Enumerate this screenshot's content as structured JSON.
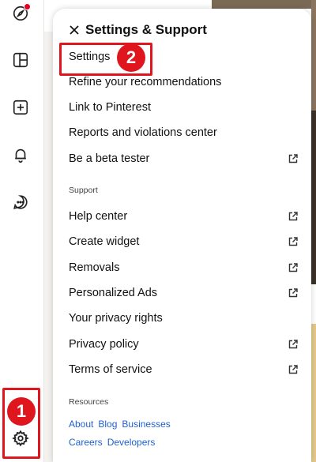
{
  "menu": {
    "title": "Settings & Support",
    "items": [
      {
        "label": "Settings",
        "external": false
      },
      {
        "label": "Refine your recommendations",
        "external": false
      },
      {
        "label": "Link to Pinterest",
        "external": false
      },
      {
        "label": "Reports and violations center",
        "external": false
      },
      {
        "label": "Be a beta tester",
        "external": true
      }
    ],
    "support_label": "Support",
    "support_items": [
      {
        "label": "Help center",
        "external": true
      },
      {
        "label": "Create widget",
        "external": true
      },
      {
        "label": "Removals",
        "external": true
      },
      {
        "label": "Personalized Ads",
        "external": true
      },
      {
        "label": "Your privacy rights",
        "external": false
      },
      {
        "label": "Privacy policy",
        "external": true
      },
      {
        "label": "Terms of service",
        "external": true
      }
    ],
    "resources_label": "Resources",
    "resources_links": [
      "About",
      "Blog",
      "Businesses",
      "Careers",
      "Developers"
    ]
  },
  "sidebar": {
    "icons": [
      "compass-icon",
      "board-icon",
      "plus-square-icon",
      "bell-icon",
      "chat-icon",
      "gear-icon"
    ]
  },
  "annotations": {
    "step1": "1",
    "step2": "2"
  },
  "colors": {
    "annotation": "#e0161e",
    "link": "#1f5fd1",
    "notification": "#e60023"
  }
}
